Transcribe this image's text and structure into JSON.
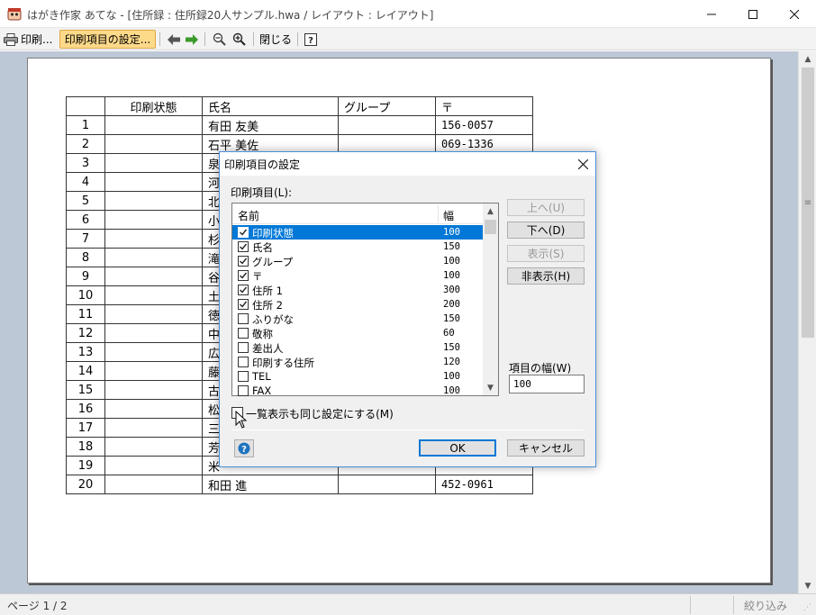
{
  "window": {
    "title": "はがき作家 あてな - [住所録 : 住所録20人サンプル.hwa / レイアウト : レイアウト]"
  },
  "toolbar": {
    "print_label": "印刷...",
    "print_settings_label": "印刷項目の設定...",
    "close_label": "閉じる"
  },
  "table": {
    "headers": [
      "",
      "印刷状態",
      "氏名",
      "グループ",
      "〒"
    ],
    "rows": [
      {
        "no": "1",
        "status": "",
        "name": "有田 友美",
        "group": "",
        "zip": "156-0057"
      },
      {
        "no": "2",
        "status": "",
        "name": "石平 美佐",
        "group": "",
        "zip": "069-1336"
      },
      {
        "no": "3",
        "status": "",
        "name": "泉",
        "group": "",
        "zip": ""
      },
      {
        "no": "4",
        "status": "",
        "name": "河",
        "group": "",
        "zip": ""
      },
      {
        "no": "5",
        "status": "",
        "name": "北",
        "group": "",
        "zip": ""
      },
      {
        "no": "6",
        "status": "",
        "name": "小",
        "group": "",
        "zip": ""
      },
      {
        "no": "7",
        "status": "",
        "name": "杉",
        "group": "",
        "zip": ""
      },
      {
        "no": "8",
        "status": "",
        "name": "滝",
        "group": "",
        "zip": ""
      },
      {
        "no": "9",
        "status": "",
        "name": "谷",
        "group": "",
        "zip": ""
      },
      {
        "no": "10",
        "status": "",
        "name": "土",
        "group": "",
        "zip": ""
      },
      {
        "no": "11",
        "status": "",
        "name": "徳",
        "group": "",
        "zip": ""
      },
      {
        "no": "12",
        "status": "",
        "name": "中",
        "group": "",
        "zip": ""
      },
      {
        "no": "13",
        "status": "",
        "name": "広",
        "group": "",
        "zip": ""
      },
      {
        "no": "14",
        "status": "",
        "name": "藤",
        "group": "",
        "zip": ""
      },
      {
        "no": "15",
        "status": "",
        "name": "古",
        "group": "",
        "zip": ""
      },
      {
        "no": "16",
        "status": "",
        "name": "松",
        "group": "",
        "zip": ""
      },
      {
        "no": "17",
        "status": "",
        "name": "三",
        "group": "",
        "zip": ""
      },
      {
        "no": "18",
        "status": "",
        "name": "芳",
        "group": "",
        "zip": ""
      },
      {
        "no": "19",
        "status": "",
        "name": "米",
        "group": "",
        "zip": ""
      },
      {
        "no": "20",
        "status": "",
        "name": "和田 進",
        "group": "",
        "zip": "452-0961"
      }
    ]
  },
  "status": {
    "page": "ページ 1 / 2",
    "filter": "絞り込み"
  },
  "dialog": {
    "title": "印刷項目の設定",
    "list_label": "印刷項目(L):",
    "col_name": "名前",
    "col_width": "幅",
    "items": [
      {
        "name": "印刷状態",
        "width": "100",
        "checked": true,
        "selected": true
      },
      {
        "name": "氏名",
        "width": "150",
        "checked": true,
        "selected": false
      },
      {
        "name": "グループ",
        "width": "100",
        "checked": true,
        "selected": false
      },
      {
        "name": "〒",
        "width": "100",
        "checked": true,
        "selected": false
      },
      {
        "name": "住所 1",
        "width": "300",
        "checked": true,
        "selected": false
      },
      {
        "name": "住所 2",
        "width": "200",
        "checked": true,
        "selected": false
      },
      {
        "name": "ふりがな",
        "width": "150",
        "checked": false,
        "selected": false
      },
      {
        "name": "敬称",
        "width": "60",
        "checked": false,
        "selected": false
      },
      {
        "name": "差出人",
        "width": "150",
        "checked": false,
        "selected": false
      },
      {
        "name": "印刷する住所",
        "width": "120",
        "checked": false,
        "selected": false
      },
      {
        "name": "TEL",
        "width": "100",
        "checked": false,
        "selected": false
      },
      {
        "name": "FAX",
        "width": "100",
        "checked": false,
        "selected": false
      }
    ],
    "up_label": "上へ(U)",
    "down_label": "下へ(D)",
    "show_label": "表示(S)",
    "hide_label": "非表示(H)",
    "width_label": "項目の幅(W)",
    "width_value": "100",
    "same_setting_label": "一覧表示も同じ設定にする(M)",
    "same_setting_checked": false,
    "ok_label": "OK",
    "cancel_label": "キャンセル"
  },
  "colors": {
    "accent": "#0078d7",
    "toolbar_highlight": "#fdd98a",
    "preview_bg": "#bdc8d6"
  }
}
